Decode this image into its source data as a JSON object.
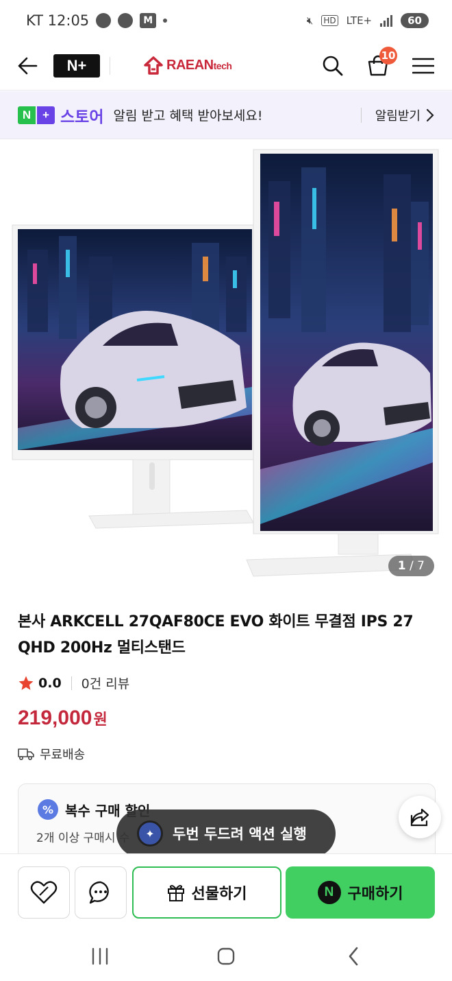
{
  "status_bar": {
    "carrier_time": "KT 12:05",
    "m_badge": "M",
    "hd": "HD",
    "network": "LTE+",
    "battery": "60"
  },
  "header": {
    "logo": "N+",
    "brand_name": "RAEAN",
    "brand_suffix": "tech",
    "cart_count": "10"
  },
  "store_banner": {
    "store_label": "스토어",
    "message": "알림 받고 혜택 받아보세요!",
    "action": "알림받기"
  },
  "gallery": {
    "current": "1",
    "total": "/ 7"
  },
  "product": {
    "title": "본사 ARKCELL 27QAF80CE EVO 화이트 무결점 IPS 27 QHD 200Hz 멀티스탠드",
    "rating": "0.0",
    "review_count": "0건 리뷰",
    "price": "219,000",
    "currency": "원",
    "shipping": "무료배송"
  },
  "discount": {
    "badge": "%",
    "title": "복수 구매 할인",
    "subtitle": "2개 이상 구매시 수"
  },
  "toast": {
    "text": "두번 두드려 액션 실행"
  },
  "actions": {
    "gift_label": "선물하기",
    "buy_label": "구매하기",
    "buy_icon_letter": "N"
  },
  "colors": {
    "accent_red": "#c4283c",
    "naver_green": "#41cf62",
    "store_purple": "#6a43e6",
    "cart_badge": "#ef5a3a"
  },
  "icons": {
    "back": "arrow-left-icon",
    "search": "search-icon",
    "cart": "cart-icon",
    "menu": "hamburger-icon",
    "share": "share-icon",
    "wishlist": "heart-icon",
    "chat": "chat-icon",
    "gift": "gift-icon"
  }
}
